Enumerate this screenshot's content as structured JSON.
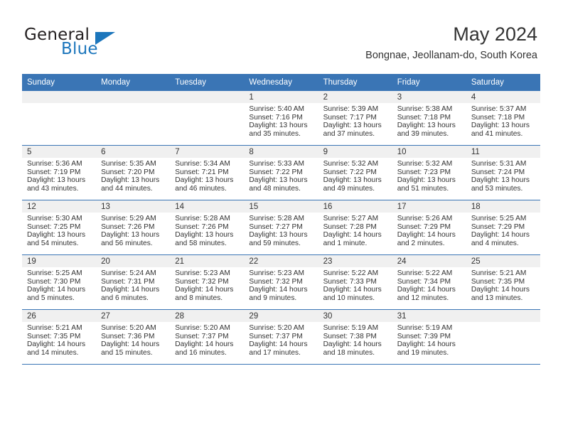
{
  "brand": {
    "name_top": "General",
    "name_bottom": "Blue",
    "accent_color": "#1c76bc",
    "triangle_icon": "triangle-icon"
  },
  "header": {
    "month_title": "May 2024",
    "location": "Bongnae, Jeollanam-do, South Korea"
  },
  "theme": {
    "header_blue": "#3a75b5",
    "daynum_strip": "#f0f0f0",
    "text": "#333333"
  },
  "weekday_headers": [
    "Sunday",
    "Monday",
    "Tuesday",
    "Wednesday",
    "Thursday",
    "Friday",
    "Saturday"
  ],
  "weeks": [
    [
      {
        "day": "",
        "empty": true
      },
      {
        "day": "",
        "empty": true
      },
      {
        "day": "",
        "empty": true
      },
      {
        "day": "1",
        "sunrise": "Sunrise: 5:40 AM",
        "sunset": "Sunset: 7:16 PM",
        "daylight1": "Daylight: 13 hours",
        "daylight2": "and 35 minutes."
      },
      {
        "day": "2",
        "sunrise": "Sunrise: 5:39 AM",
        "sunset": "Sunset: 7:17 PM",
        "daylight1": "Daylight: 13 hours",
        "daylight2": "and 37 minutes."
      },
      {
        "day": "3",
        "sunrise": "Sunrise: 5:38 AM",
        "sunset": "Sunset: 7:18 PM",
        "daylight1": "Daylight: 13 hours",
        "daylight2": "and 39 minutes."
      },
      {
        "day": "4",
        "sunrise": "Sunrise: 5:37 AM",
        "sunset": "Sunset: 7:18 PM",
        "daylight1": "Daylight: 13 hours",
        "daylight2": "and 41 minutes."
      }
    ],
    [
      {
        "day": "5",
        "sunrise": "Sunrise: 5:36 AM",
        "sunset": "Sunset: 7:19 PM",
        "daylight1": "Daylight: 13 hours",
        "daylight2": "and 43 minutes."
      },
      {
        "day": "6",
        "sunrise": "Sunrise: 5:35 AM",
        "sunset": "Sunset: 7:20 PM",
        "daylight1": "Daylight: 13 hours",
        "daylight2": "and 44 minutes."
      },
      {
        "day": "7",
        "sunrise": "Sunrise: 5:34 AM",
        "sunset": "Sunset: 7:21 PM",
        "daylight1": "Daylight: 13 hours",
        "daylight2": "and 46 minutes."
      },
      {
        "day": "8",
        "sunrise": "Sunrise: 5:33 AM",
        "sunset": "Sunset: 7:22 PM",
        "daylight1": "Daylight: 13 hours",
        "daylight2": "and 48 minutes."
      },
      {
        "day": "9",
        "sunrise": "Sunrise: 5:32 AM",
        "sunset": "Sunset: 7:22 PM",
        "daylight1": "Daylight: 13 hours",
        "daylight2": "and 49 minutes."
      },
      {
        "day": "10",
        "sunrise": "Sunrise: 5:32 AM",
        "sunset": "Sunset: 7:23 PM",
        "daylight1": "Daylight: 13 hours",
        "daylight2": "and 51 minutes."
      },
      {
        "day": "11",
        "sunrise": "Sunrise: 5:31 AM",
        "sunset": "Sunset: 7:24 PM",
        "daylight1": "Daylight: 13 hours",
        "daylight2": "and 53 minutes."
      }
    ],
    [
      {
        "day": "12",
        "sunrise": "Sunrise: 5:30 AM",
        "sunset": "Sunset: 7:25 PM",
        "daylight1": "Daylight: 13 hours",
        "daylight2": "and 54 minutes."
      },
      {
        "day": "13",
        "sunrise": "Sunrise: 5:29 AM",
        "sunset": "Sunset: 7:26 PM",
        "daylight1": "Daylight: 13 hours",
        "daylight2": "and 56 minutes."
      },
      {
        "day": "14",
        "sunrise": "Sunrise: 5:28 AM",
        "sunset": "Sunset: 7:26 PM",
        "daylight1": "Daylight: 13 hours",
        "daylight2": "and 58 minutes."
      },
      {
        "day": "15",
        "sunrise": "Sunrise: 5:28 AM",
        "sunset": "Sunset: 7:27 PM",
        "daylight1": "Daylight: 13 hours",
        "daylight2": "and 59 minutes."
      },
      {
        "day": "16",
        "sunrise": "Sunrise: 5:27 AM",
        "sunset": "Sunset: 7:28 PM",
        "daylight1": "Daylight: 14 hours",
        "daylight2": "and 1 minute."
      },
      {
        "day": "17",
        "sunrise": "Sunrise: 5:26 AM",
        "sunset": "Sunset: 7:29 PM",
        "daylight1": "Daylight: 14 hours",
        "daylight2": "and 2 minutes."
      },
      {
        "day": "18",
        "sunrise": "Sunrise: 5:25 AM",
        "sunset": "Sunset: 7:29 PM",
        "daylight1": "Daylight: 14 hours",
        "daylight2": "and 4 minutes."
      }
    ],
    [
      {
        "day": "19",
        "sunrise": "Sunrise: 5:25 AM",
        "sunset": "Sunset: 7:30 PM",
        "daylight1": "Daylight: 14 hours",
        "daylight2": "and 5 minutes."
      },
      {
        "day": "20",
        "sunrise": "Sunrise: 5:24 AM",
        "sunset": "Sunset: 7:31 PM",
        "daylight1": "Daylight: 14 hours",
        "daylight2": "and 6 minutes."
      },
      {
        "day": "21",
        "sunrise": "Sunrise: 5:23 AM",
        "sunset": "Sunset: 7:32 PM",
        "daylight1": "Daylight: 14 hours",
        "daylight2": "and 8 minutes."
      },
      {
        "day": "22",
        "sunrise": "Sunrise: 5:23 AM",
        "sunset": "Sunset: 7:32 PM",
        "daylight1": "Daylight: 14 hours",
        "daylight2": "and 9 minutes."
      },
      {
        "day": "23",
        "sunrise": "Sunrise: 5:22 AM",
        "sunset": "Sunset: 7:33 PM",
        "daylight1": "Daylight: 14 hours",
        "daylight2": "and 10 minutes."
      },
      {
        "day": "24",
        "sunrise": "Sunrise: 5:22 AM",
        "sunset": "Sunset: 7:34 PM",
        "daylight1": "Daylight: 14 hours",
        "daylight2": "and 12 minutes."
      },
      {
        "day": "25",
        "sunrise": "Sunrise: 5:21 AM",
        "sunset": "Sunset: 7:35 PM",
        "daylight1": "Daylight: 14 hours",
        "daylight2": "and 13 minutes."
      }
    ],
    [
      {
        "day": "26",
        "sunrise": "Sunrise: 5:21 AM",
        "sunset": "Sunset: 7:35 PM",
        "daylight1": "Daylight: 14 hours",
        "daylight2": "and 14 minutes."
      },
      {
        "day": "27",
        "sunrise": "Sunrise: 5:20 AM",
        "sunset": "Sunset: 7:36 PM",
        "daylight1": "Daylight: 14 hours",
        "daylight2": "and 15 minutes."
      },
      {
        "day": "28",
        "sunrise": "Sunrise: 5:20 AM",
        "sunset": "Sunset: 7:37 PM",
        "daylight1": "Daylight: 14 hours",
        "daylight2": "and 16 minutes."
      },
      {
        "day": "29",
        "sunrise": "Sunrise: 5:20 AM",
        "sunset": "Sunset: 7:37 PM",
        "daylight1": "Daylight: 14 hours",
        "daylight2": "and 17 minutes."
      },
      {
        "day": "30",
        "sunrise": "Sunrise: 5:19 AM",
        "sunset": "Sunset: 7:38 PM",
        "daylight1": "Daylight: 14 hours",
        "daylight2": "and 18 minutes."
      },
      {
        "day": "31",
        "sunrise": "Sunrise: 5:19 AM",
        "sunset": "Sunset: 7:39 PM",
        "daylight1": "Daylight: 14 hours",
        "daylight2": "and 19 minutes."
      },
      {
        "day": "",
        "empty": true
      }
    ]
  ]
}
